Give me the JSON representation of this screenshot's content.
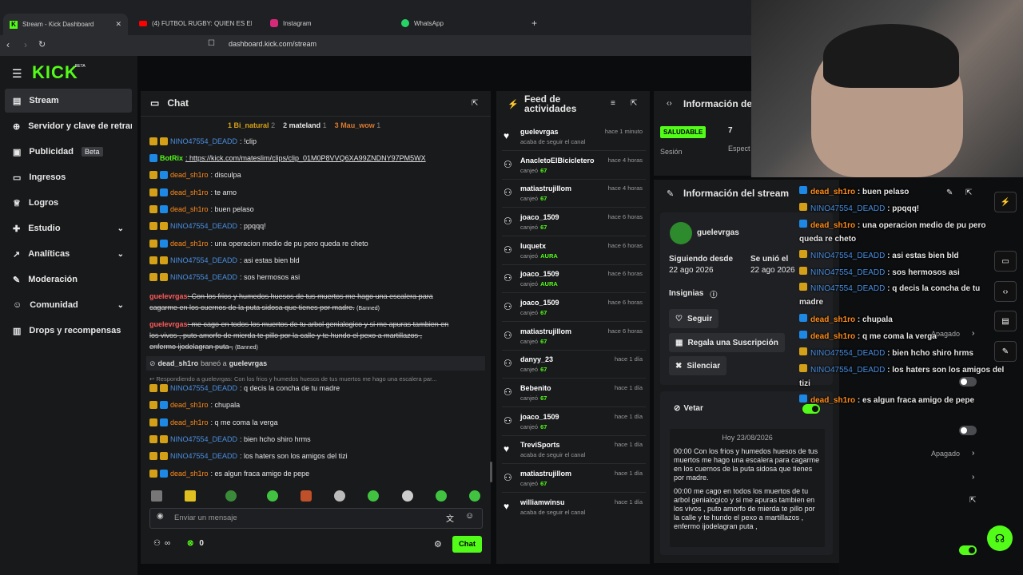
{
  "browser": {
    "tabs": [
      {
        "label": "Stream - Kick Dashboard"
      },
      {
        "label": "(4) FUTBOL RUGBY: QUIEN ES EL ME"
      },
      {
        "label": "Instagram"
      },
      {
        "label": "WhatsApp"
      }
    ],
    "url": "dashboard.kick.com/stream"
  },
  "brand": {
    "logo": "KICK",
    "beta": "BETA",
    "accent": "#53fc18"
  },
  "nav": {
    "items": [
      {
        "label": "Stream"
      },
      {
        "label": "Servidor y clave de retrans"
      },
      {
        "label": "Publicidad",
        "badge": "Beta"
      },
      {
        "label": "Ingresos"
      },
      {
        "label": "Logros"
      },
      {
        "label": "Estudio"
      },
      {
        "label": "Analíticas"
      },
      {
        "label": "Moderación"
      },
      {
        "label": "Comunidad"
      },
      {
        "label": "Drops y recompensas"
      }
    ]
  },
  "chat": {
    "title": "Chat",
    "top": [
      {
        "rank": "1",
        "name": "Bi_natural",
        "count": "2"
      },
      {
        "rank": "2",
        "name": "mateland",
        "count": "1"
      },
      {
        "rank": "3",
        "name": "Mau_wow",
        "count": "1"
      }
    ],
    "messages": [
      {
        "user": "NINO47554_DEADD",
        "text": ": !clip"
      },
      {
        "user": "BotRix",
        "text": ": https://kick.com/mateslim/clips/clip_01M0P8VVQ6XA99ZNDNY97PM5WX"
      },
      {
        "user": "dead_sh1ro",
        "text": ": disculpa"
      },
      {
        "user": "dead_sh1ro",
        "text": ": te amo"
      },
      {
        "user": "dead_sh1ro",
        "text": ": buen pelaso"
      },
      {
        "user": "NINO47554_DEADD",
        "text": ": ppqqq!"
      },
      {
        "user": "dead_sh1ro",
        "text": ": una operacion medio de pu pero queda re cheto"
      },
      {
        "user": "NINO47554_DEADD",
        "text": ": asi estas bien bld"
      },
      {
        "user": "NINO47554_DEADD",
        "text": ": sos hermosos asi"
      }
    ],
    "banned1": {
      "user": "guelevrgas",
      "line1": ": Con los frios y humedos huesos de tus muertos me hago una escalera para",
      "line2": "cagarme en los cuernos de la puta sidosa que tienes por madre.",
      "tag": "(Banned)"
    },
    "banned2": {
      "user": "guelevrgas",
      "line1": ": me cago en todos los muertos de tu arbol genialogico y si me apuras tambien en",
      "line2": "los vivos , puto amorfo de mierda te pillo por la calle y te hundo el pexo a martillazos ,",
      "line3": "enfermo ijodelagran puta ,",
      "tag": "(Banned)"
    },
    "ban_notice": {
      "mod": "dead_sh1ro",
      "action": "baneó a",
      "target": "guelevrgas"
    },
    "reply_notice": "Respondiendo a guelevrgas: Con los frios y humedos huesos de tus muertos me hago una escalera par...",
    "messages2": [
      {
        "user": "NINO47554_DEADD",
        "text": ": q decis la concha de tu madre"
      },
      {
        "user": "dead_sh1ro",
        "text": ": chupala"
      },
      {
        "user": "dead_sh1ro",
        "text": ": q me coma la verga"
      },
      {
        "user": "NINO47554_DEADD",
        "text": ": bien hcho shiro hrms"
      },
      {
        "user": "NINO47554_DEADD",
        "text": ": los haters son los amigos del tizi"
      },
      {
        "user": "dead_sh1ro",
        "text": ": es algun fraca amigo de pepe"
      }
    ],
    "input_placeholder": "Enviar un mensaje",
    "viewers": "∞",
    "points": "0",
    "send_label": "Chat"
  },
  "feed": {
    "title_line1": "Feed de",
    "title_line2": "actividades",
    "items": [
      {
        "name": "guelevrgas",
        "sub": "acaba de seguir el canal",
        "time": "hace 1 minuto",
        "icon": "heart"
      },
      {
        "name": "AnacletoElBicicletero",
        "sub": "canjeó",
        "amount": "67",
        "time": "hace 4 horas",
        "icon": "points"
      },
      {
        "name": "matiastrujillom",
        "sub": "canjeó",
        "amount": "67",
        "time": "hace 4 horas",
        "icon": "points"
      },
      {
        "name": "joaco_1509",
        "sub": "canjeó",
        "amount": "67",
        "time": "hace 6 horas",
        "icon": "points"
      },
      {
        "name": "luquetx",
        "sub": "canjeó",
        "amount": "AURA",
        "time": "hace 6 horas",
        "icon": "points"
      },
      {
        "name": "joaco_1509",
        "sub": "canjeó",
        "amount": "AURA",
        "time": "hace 6 horas",
        "icon": "points"
      },
      {
        "name": "joaco_1509",
        "sub": "canjeó",
        "amount": "67",
        "time": "hace 6 horas",
        "icon": "points"
      },
      {
        "name": "matiastrujillom",
        "sub": "canjeó",
        "amount": "67",
        "time": "hace 6 horas",
        "icon": "points"
      },
      {
        "name": "danyy_23",
        "sub": "canjeó",
        "amount": "67",
        "time": "hace 1 día",
        "icon": "points"
      },
      {
        "name": "Bebenito",
        "sub": "canjeó",
        "amount": "67",
        "time": "hace 1 día",
        "icon": "points"
      },
      {
        "name": "joaco_1509",
        "sub": "canjeó",
        "amount": "67",
        "time": "hace 1 día",
        "icon": "points"
      },
      {
        "name": "TreviSports",
        "sub": "acaba de seguir el canal",
        "time": "hace 1 día",
        "icon": "heart"
      },
      {
        "name": "matiastrujillom",
        "sub": "canjeó",
        "amount": "67",
        "time": "hace 1 día",
        "icon": "points"
      },
      {
        "name": "williamwinsu",
        "sub": "acaba de seguir el canal",
        "time": "hace 1 día",
        "icon": "heart"
      }
    ]
  },
  "info_top": {
    "title": "Información de",
    "status": "SALUDABLE",
    "session": "Sesión",
    "viewers": "7",
    "spect": "Espect"
  },
  "stream_info": {
    "title": "Información del stream",
    "user": "guelevrgas",
    "following_label": "Siguiendo desde",
    "following_date": "22 ago 2026",
    "joined_label": "Se unió el",
    "joined_date": "22 ago 2026",
    "badges_label": "Insignias",
    "follow_btn": "Seguir",
    "gift_btn": "Regala una Suscripción",
    "silence_btn": "Silenciar",
    "veto_label": "Vetar",
    "log_date": "Hoy 23/08/2026",
    "log1": "00:00 Con los frios y humedos huesos de tus muertos me hago una escalera para cagarme en los cuernos de la puta sidosa que tienes por madre.",
    "log2": "00:00 me cago en todos los muertos de tu arbol genialogico y si me apuras tambien en los vivos , puto amorfo de mierda te pillo por la calle y te hundo el pexo a martillazos , enfermo ijodelagran puta ,"
  },
  "overlay": {
    "messages": [
      {
        "user": "dead_sh1ro",
        "text": " : buen pelaso"
      },
      {
        "user": "NINO47554_DEADD",
        "text": " : ppqqq!"
      },
      {
        "user": "dead_sh1ro",
        "text": " : una operacion medio de pu pero",
        "text2": "queda re cheto"
      },
      {
        "user": "NINO47554_DEADD",
        "text": " : asi estas bien bld"
      },
      {
        "user": "NINO47554_DEADD",
        "text": " : sos hermosos asi"
      },
      {
        "user": "NINO47554_DEADD",
        "text": " : q decis la concha de tu",
        "text2": "madre"
      },
      {
        "user": "dead_sh1ro",
        "text": " : chupala"
      },
      {
        "user": "dead_sh1ro",
        "text": " : q me coma la verga"
      },
      {
        "user": "NINO47554_DEADD",
        "text": " : bien hcho shiro hrms"
      },
      {
        "user": "NINO47554_DEADD",
        "text": " : los haters son los amigos del",
        "text2": "tizi"
      },
      {
        "user": "dead_sh1ro",
        "text": " : es algun fraca amigo de pepe"
      }
    ],
    "apagado1": "Apagado",
    "apagado2": "Apagado"
  }
}
